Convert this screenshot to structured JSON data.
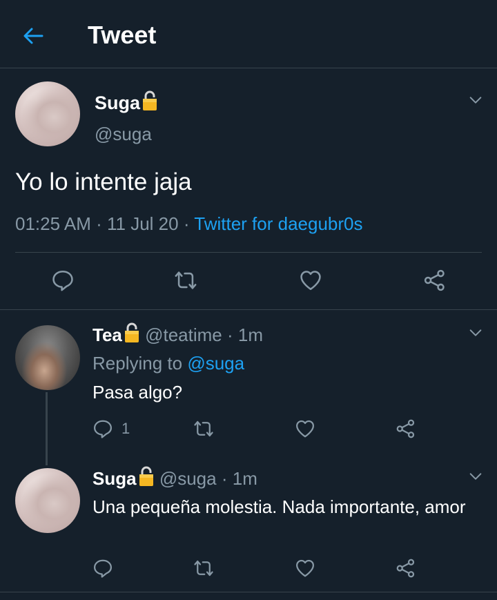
{
  "header": {
    "title": "Tweet"
  },
  "main_tweet": {
    "name": "Suga",
    "handle": "@suga",
    "text": "Yo lo intente jaja",
    "time": "01:25 AM",
    "sep1": "·",
    "date": "11 Jul 20",
    "sep2": "·",
    "source": "Twitter for daegubr0s"
  },
  "replies": [
    {
      "name": "Tea",
      "handle": "@teatime",
      "sep": "·",
      "time": "1m",
      "replying_label": "Replying to",
      "replying_handle": "@suga",
      "text": "Pasa algo?",
      "reply_count": "1"
    },
    {
      "name": "Suga",
      "handle": "@suga",
      "sep": "·",
      "time": "1m",
      "text": "Una pequeña molestia. Nada importante, amor"
    }
  ],
  "icons": [
    "arrow-left-icon",
    "lock-icon",
    "chevron-down-icon",
    "reply-icon",
    "retweet-icon",
    "like-icon",
    "share-icon"
  ],
  "colors": {
    "background": "#15202b",
    "accent": "#1da1f2",
    "muted": "#8899a6",
    "divider": "#38444d",
    "lock": "#f5b722"
  }
}
